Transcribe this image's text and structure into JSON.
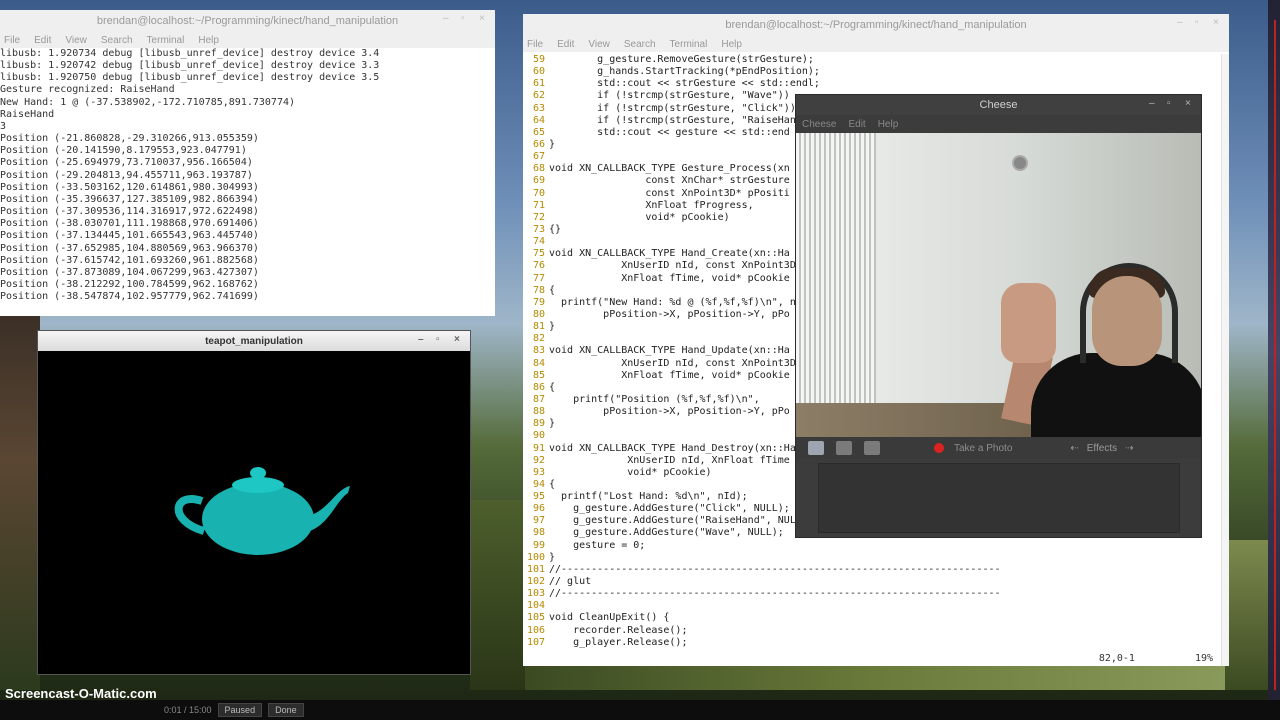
{
  "term_left": {
    "title": "brendan@localhost:~/Programming/kinect/hand_manipulation",
    "menu": [
      "File",
      "Edit",
      "View",
      "Search",
      "Terminal",
      "Help"
    ],
    "lines": [
      "libusb: 1.920734 debug [libusb_unref_device] destroy device 3.4",
      "libusb: 1.920742 debug [libusb_unref_device] destroy device 3.3",
      "libusb: 1.920750 debug [libusb_unref_device] destroy device 3.5",
      "Gesture recognized: RaiseHand",
      "New Hand: 1 @ (-37.538902,-172.710785,891.730774)",
      "RaiseHand",
      "3",
      "Position (-21.860828,-29.310266,913.055359)",
      "Position (-20.141590,8.179553,923.047791)",
      "Position (-25.694979,73.710037,956.166504)",
      "Position (-29.204813,94.455711,963.193787)",
      "Position (-33.503162,120.614861,980.304993)",
      "Position (-35.396637,127.385109,982.866394)",
      "Position (-37.309536,114.316917,972.622498)",
      "Position (-38.030701,111.198868,970.691406)",
      "Position (-37.134445,101.665543,963.445740)",
      "Position (-37.652985,104.880569,963.966370)",
      "Position (-37.615742,101.693260,961.882568)",
      "Position (-37.873089,104.067299,963.427307)",
      "Position (-38.212292,100.784599,962.168762)",
      "Position (-38.547874,102.957779,962.741699)"
    ]
  },
  "term_right": {
    "title": "brendan@localhost:~/Programming/kinect/hand_manipulation",
    "menu": [
      "File",
      "Edit",
      "View",
      "Search",
      "Terminal",
      "Help"
    ],
    "status_pos": "82,0-1",
    "status_pct": "19%"
  },
  "cheese": {
    "title": "Cheese",
    "menu": [
      "Cheese",
      "Edit",
      "Help"
    ],
    "take_photo": "Take a Photo",
    "effects": "Effects"
  },
  "teapot": {
    "title": "teapot_manipulation",
    "color": "#18b3b0"
  },
  "taskbar": {
    "watermark": "Screencast-O-Matic.com",
    "timer": "0:01 / 15:00",
    "btn1": "Paused",
    "btn2": "Done"
  }
}
